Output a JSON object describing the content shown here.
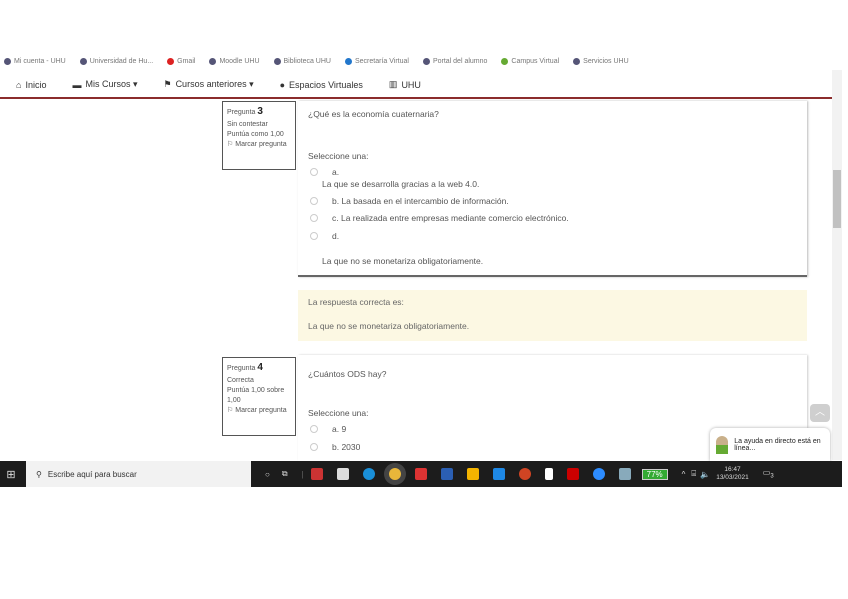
{
  "bookmarks": [
    "Mi cuenta - UHU",
    "Universidad de Hu...",
    "Gmail",
    "Moodle UHU",
    "Biblioteca UHU",
    "Secretaría Virtual",
    "Portal del alumno",
    "Campus Virtual",
    "Servicios UHU"
  ],
  "nav": {
    "items": [
      "Inicio",
      "Mis Cursos ▾",
      "Cursos anteriores ▾",
      "Espacios Virtuales",
      "UHU"
    ]
  },
  "q3": {
    "label": "Pregunta",
    "number": "3",
    "status": "Sin contestar",
    "score": "Puntúa como 1,00",
    "flag": "Marcar pregunta",
    "text": "¿Qué es la economía cuaternaria?",
    "select": "Seleccione una:",
    "options": [
      "a.",
      "La que se desarrolla gracias a la web 4.0.",
      "b. La basada en el intercambio de información.",
      "c. La realizada entre empresas mediante comercio electrónico.",
      "d.",
      "La que no se monetariza obligatoriamente."
    ]
  },
  "answer": {
    "title": "La respuesta correcta es:",
    "text": "La que no se monetariza obligatoriamente."
  },
  "q4": {
    "label": "Pregunta",
    "number": "4",
    "status": "Correcta",
    "score": "Puntúa 1,00 sobre 1,00",
    "flag": "Marcar pregunta",
    "text": "¿Cuántos ODS hay?",
    "select": "Seleccione una:",
    "options": [
      "a. 9",
      "b. 2030"
    ]
  },
  "chat": {
    "text": "La ayuda en directo está en línea..."
  },
  "taskbar": {
    "search_placeholder": "Escribe aquí para buscar",
    "battery": "77%",
    "time": "16:47",
    "date": "13/03/2021",
    "notifications": "3"
  }
}
